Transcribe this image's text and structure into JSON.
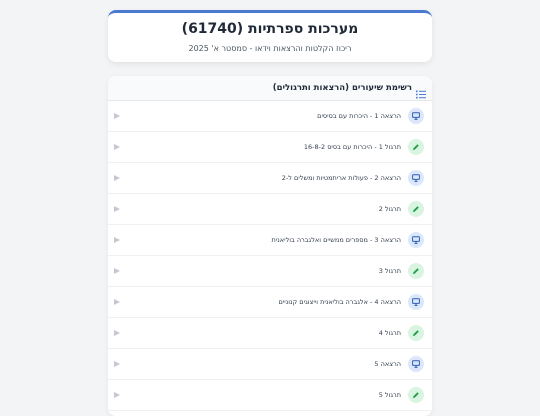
{
  "header": {
    "title": "מערכות ספרתיות (61740)",
    "subtitle": "ריכוז הקלטות והרצאות וידאו - סמסטר א' 2025"
  },
  "list": {
    "title": "רשימת שיעורים (הרצאות ותרגולים)",
    "header_icon": "list-icon",
    "items": [
      {
        "label": "הרצאה 1 - היכרות עם בסיסים",
        "kind": "lecture",
        "icon": "presentation-icon"
      },
      {
        "label": "תרגול 1 - היכרות עם בסיס 16-8-2",
        "kind": "practice",
        "icon": "pencil-icon"
      },
      {
        "label": "הרצאה 2 - פעולות אריתמטיות ומשלים ל-2",
        "kind": "lecture",
        "icon": "presentation-icon"
      },
      {
        "label": "תרגול 2",
        "kind": "practice",
        "icon": "pencil-icon"
      },
      {
        "label": "הרצאה 3 - מספרים ממשיים ואלגברה בוליאנית",
        "kind": "lecture",
        "icon": "presentation-icon"
      },
      {
        "label": "תרגול 3",
        "kind": "practice",
        "icon": "pencil-icon"
      },
      {
        "label": "הרצאה 4 - אלגברה בוליאנית וייצוגים קנוניים",
        "kind": "lecture",
        "icon": "presentation-icon"
      },
      {
        "label": "תרגול 4",
        "kind": "practice",
        "icon": "pencil-icon"
      },
      {
        "label": "הרצאה 5",
        "kind": "lecture",
        "icon": "presentation-icon"
      },
      {
        "label": "תרגול 5",
        "kind": "practice",
        "icon": "pencil-icon"
      }
    ]
  },
  "colors": {
    "accent": "#4a7bd0",
    "lecture_icon_bg": "#dbe7fb",
    "lecture_icon_fg": "#2f5fb3",
    "practice_icon_bg": "#d9f5e1",
    "practice_icon_fg": "#22a04b",
    "play_icon": "#c4c9d1"
  }
}
